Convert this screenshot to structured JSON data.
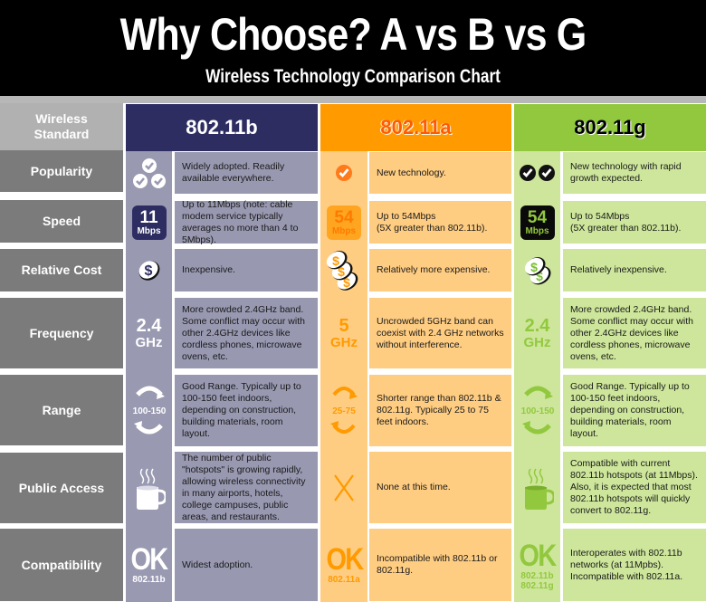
{
  "header": {
    "title": "Why Choose?  A vs B vs G",
    "subtitle": "Wireless Technology Comparison Chart"
  },
  "row_labels": {
    "standard": "Wireless Standard",
    "popularity": "Popularity",
    "speed": "Speed",
    "cost": "Relative Cost",
    "frequency": "Frequency",
    "range": "Range",
    "public_access": "Public Access",
    "compatibility": "Compatibility"
  },
  "colors": {
    "b_header": "#2d2d62",
    "b_body": "#9898b1",
    "a_header": "#ff9a00",
    "a_body": "#ffcd82",
    "g_header": "#92c83e",
    "g_body": "#cde69b",
    "label_gray": "#7b7b7b"
  },
  "columns": {
    "b": {
      "name": "802.11b",
      "popularity": {
        "icon": "three-check-icon",
        "checks": 3,
        "text": "Widely adopted. Readily available everywhere."
      },
      "speed": {
        "value": "11",
        "unit": "Mbps",
        "text": "Up to 11Mbps (note: cable modem service typically averages no more than 4 to 5Mbps)."
      },
      "cost": {
        "icon": "dollar-coin-icon",
        "coins": 1,
        "text": "Inexpensive."
      },
      "frequency": {
        "value": "2.4",
        "unit": "GHz",
        "text": "More crowded 2.4GHz band. Some conflict may occur with other 2.4GHz devices like cordless phones, microwave ovens, etc."
      },
      "range": {
        "value": "100-150",
        "text": "Good Range. Typically up to 100-150 feet indoors, depending on construction, building materials, room layout."
      },
      "public_access": {
        "icon": "coffee-mug-icon",
        "text": "The number of public \"hotspots\" is growing rapidly, allowing wireless connectivity in many airports, hotels, college campuses, public areas, and restaurants."
      },
      "compatibility": {
        "badge": "OK",
        "standards": [
          "802.11b"
        ],
        "text": "Widest adoption."
      }
    },
    "a": {
      "name": "802.11a",
      "popularity": {
        "icon": "check-icon",
        "checks": 1,
        "text": "New technology."
      },
      "speed": {
        "value": "54",
        "unit": "Mbps",
        "text": "Up to 54Mbps\n(5X greater than 802.11b)."
      },
      "cost": {
        "icon": "dollar-coins-icon",
        "coins": 3,
        "text": "Relatively more expensive."
      },
      "frequency": {
        "value": "5",
        "unit": "GHz",
        "text": "Uncrowded 5GHz band can coexist with 2.4 GHz networks without interference."
      },
      "range": {
        "value": "25-75",
        "text": "Shorter range than 802.11b & 802.11g. Typically 25 to 75 feet indoors."
      },
      "public_access": {
        "icon": "x-icon",
        "text": "None at this time."
      },
      "compatibility": {
        "badge": "OK",
        "standards": [
          "802.11a"
        ],
        "text": "Incompatible with 802.11b or 802.11g."
      }
    },
    "g": {
      "name": "802.11g",
      "popularity": {
        "icon": "two-check-icon",
        "checks": 2,
        "text": "New technology with rapid growth expected."
      },
      "speed": {
        "value": "54",
        "unit": "Mbps",
        "text": "Up to 54Mbps\n(5X greater than 802.11b)."
      },
      "cost": {
        "icon": "dollar-coins-icon",
        "coins": 2,
        "text": "Relatively inexpensive."
      },
      "frequency": {
        "value": "2.4",
        "unit": "GHz",
        "text": "More crowded 2.4GHz band. Some conflict may occur with other 2.4GHz devices like cordless phones, microwave ovens, etc."
      },
      "range": {
        "value": "100-150",
        "text": "Good Range. Typically up to 100-150 feet indoors, depending on construction, building materials, room layout."
      },
      "public_access": {
        "icon": "coffee-mug-icon",
        "text": "Compatible with current 802.11b hotspots (at 11Mbps). Also, it is expected that most 802.11b hotspots will quickly convert to 802.11g."
      },
      "compatibility": {
        "badge": "OK",
        "standards": [
          "802.11b",
          "802.11g"
        ],
        "text": "Interoperates with 802.11b networks (at 11Mpbs). Incompatible with 802.11a."
      }
    }
  }
}
